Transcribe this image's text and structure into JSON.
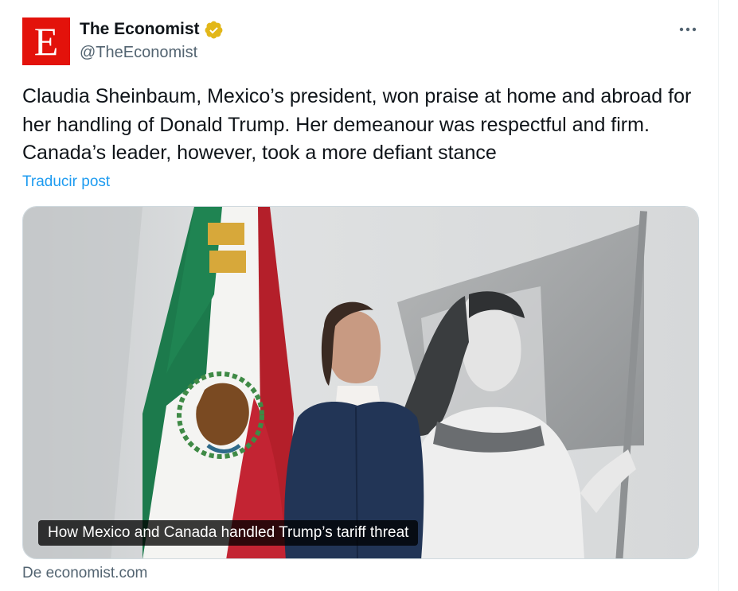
{
  "author": {
    "display_name": "The Economist",
    "handle": "@TheEconomist",
    "avatar_letter": "E",
    "verified": true,
    "brand_color": "#e3120b",
    "badge_color": "#e2b719"
  },
  "post": {
    "text": "Claudia Sheinbaum, Mexico’s president, won praise at home and abroad for her handling of Donald Trump. Her demeanour was respectful and firm. Canada’s leader, however, took a more defiant stance",
    "translate_label": "Traducir post"
  },
  "card": {
    "caption": "How Mexico and Canada handled Trump’s tariff threat",
    "source": "De economist.com"
  },
  "icons": {
    "verified": "verified-badge-icon",
    "more": "more-options-icon"
  },
  "colors": {
    "link": "#1d9bf0",
    "secondary_text": "#536471"
  }
}
